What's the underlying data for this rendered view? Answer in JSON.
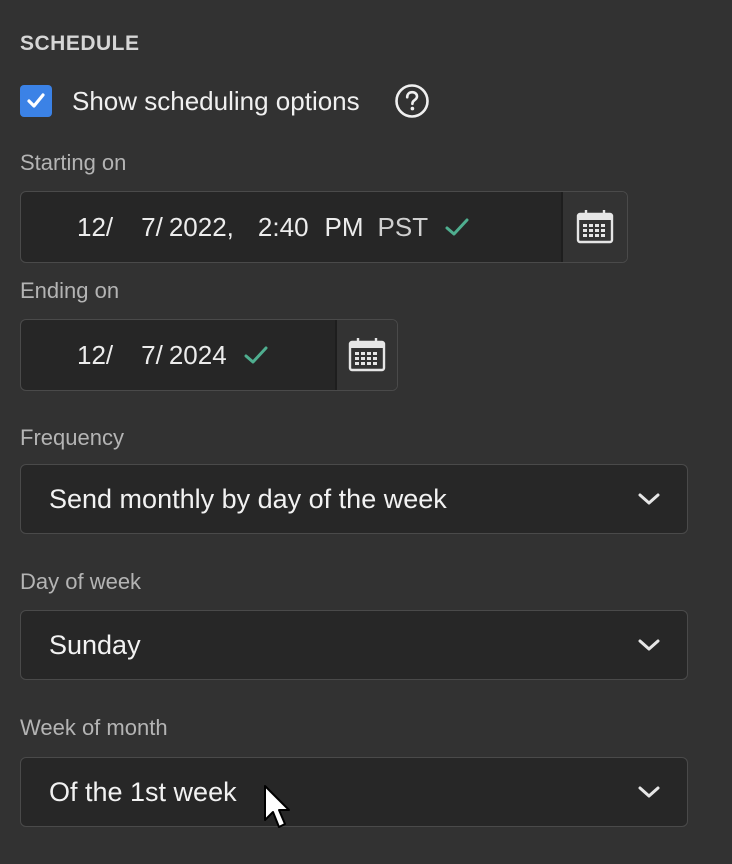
{
  "section": {
    "title": "SCHEDULE"
  },
  "show_scheduling": {
    "label": "Show scheduling options",
    "checked": true,
    "icon": "check-icon",
    "help_icon": "question-circle-icon"
  },
  "starting_on": {
    "label": "Starting on",
    "month": "12/",
    "day": "7/",
    "year": "2022,",
    "time": "2:40",
    "ampm": "PM",
    "timezone": "PST",
    "valid_icon": "checkmark-icon",
    "calendar_icon": "calendar-icon"
  },
  "ending_on": {
    "label": "Ending on",
    "month": "12/",
    "day": "7/",
    "year": "2024",
    "valid_icon": "checkmark-icon",
    "calendar_icon": "calendar-icon"
  },
  "frequency": {
    "label": "Frequency",
    "value": "Send monthly by day of the week",
    "icon": "chevron-down-icon"
  },
  "day_of_week": {
    "label": "Day of week",
    "value": "Sunday",
    "icon": "chevron-down-icon"
  },
  "week_of_month": {
    "label": "Week of month",
    "value": "Of the 1st week",
    "icon": "chevron-down-icon"
  },
  "colors": {
    "background": "#323232",
    "field_background": "#262626",
    "checkbox_accent": "#3b82e6",
    "valid_check": "#4fae8f",
    "label_text": "#b4b4b4",
    "value_text": "#f2f2f2"
  }
}
